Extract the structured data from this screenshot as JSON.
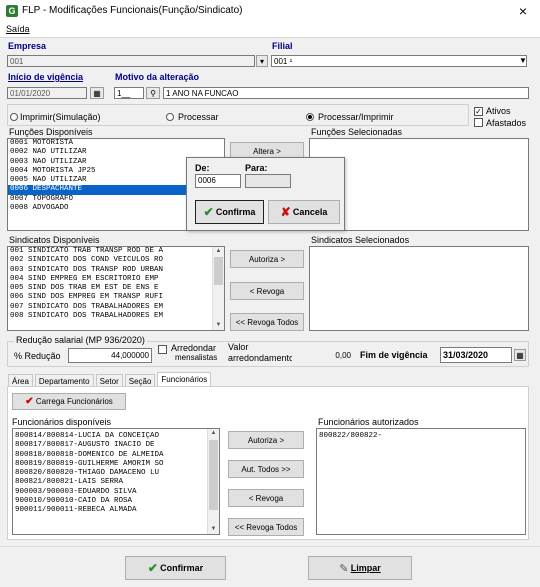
{
  "window": {
    "title": "FLP - Modificações Funcionais(Função/Sindicato)",
    "icon_letter": "G",
    "close": "×"
  },
  "menu": {
    "saida": "Saída"
  },
  "empresa": {
    "label": "Empresa",
    "value": "001"
  },
  "filial": {
    "label": "Filial",
    "value": "001 ¹"
  },
  "vigencia": {
    "label": "Início de vigência",
    "value": "01/01/2020"
  },
  "motivo": {
    "label": "Motivo da alteração",
    "code": "1__",
    "text": "1 ANO NA FUNCAO"
  },
  "mode": {
    "imprimir": "Imprimir(Simulação)",
    "processar": "Processar",
    "processar_imprimir": "Processar/Imprimir",
    "selected": "processar_imprimir"
  },
  "filters": {
    "ativos": "Ativos",
    "afastados": "Afastados"
  },
  "funcoes": {
    "disponiveis_label": "Funções Disponíveis",
    "selecionadas_label": "Funções Selecionadas",
    "items": [
      "0001 MOTORISTA",
      "0002 NAO UTILIZAR",
      "0003 NAO UTILIZAR",
      "0004 MOTORISTA JP25",
      "0005 NAO UTILIZAR",
      "0006 DESPACHANTE",
      "0007 TOPOGRAFO",
      "0008 ADVOGADO"
    ],
    "selected_index": 5,
    "altera_btn": "Altera >"
  },
  "popup": {
    "de_label": "De:",
    "para_label": "Para:",
    "de_value": "0006",
    "para_value": "",
    "confirma": "Confirma",
    "cancela": "Cancela"
  },
  "sindicatos": {
    "disponiveis_label": "Sindicatos Disponíveis",
    "selecionados_label": "Sindicatos Selecionados",
    "items": [
      "001 SINDICATO TRAB TRANSP ROD DE A",
      "002 SINDICATO DOS COND VEICULOS RO",
      "003 SINDICATO DOS TRANSP ROD URBAN",
      "004 SIND EMPREG EM ESCRITORIO EMP",
      "005 SIND DOS TRAB EM EST DE ENS E",
      "006 SIND DOS EMPREG EM TRANSP RUFI",
      "007 SINDICATO DOS TRABALHADORES EM",
      "008 SINDICATO DOS TRABALHADORES EM"
    ],
    "autoriza": "Autoriza >",
    "revoga": "< Revoga",
    "revoga_todos": "<< Revoga Todos"
  },
  "reducao": {
    "group_label": "Redução salarial (MP 936/2020)",
    "pct_label": "% Redução",
    "pct_value": "44,000000",
    "arredondar_l1": "Arredondar",
    "arredondar_l2": "mensalistas",
    "valor_l1": "Valor",
    "valor_l2": "arredondamento",
    "valor_value": "0,00",
    "fim_label": "Fim de vigência",
    "fim_value": "31/03/2020"
  },
  "tabs": [
    "Área",
    "Departamento",
    "Setor",
    "Seção",
    "Funcionários"
  ],
  "active_tab": 4,
  "funcionarios": {
    "carrega": "Carrega Funcionários",
    "disponiveis_label": "Funcionários disponíveis",
    "autorizados_label": "Funcionários autorizados",
    "items": [
      "800814/800814-LÚCIA DA CONCEIÇÃO",
      "800817/800817-AUGUSTO INACIO DE",
      "800818/800818-DOMENICO DE ALMEIDA",
      "800819/800819-GUILHERME AMORIM SO",
      "800820/800820-THIAGO DAMACENO LU",
      "800821/800821-LAIS SERRA",
      "900003/900003-EDUARDO SILVA",
      "900010/900010-CAIO DA ROSA",
      "900011/900011-REBECA ALMADA"
    ],
    "autorizados": [
      "800822/800822-"
    ],
    "autoriza": "Autoriza >",
    "aut_todos": "Aut. Todos >>",
    "revoga": "< Revoga",
    "revoga_todos": "<< Revoga Todos"
  },
  "footer": {
    "confirmar": "Confirmar",
    "limpar": "Limpar"
  }
}
